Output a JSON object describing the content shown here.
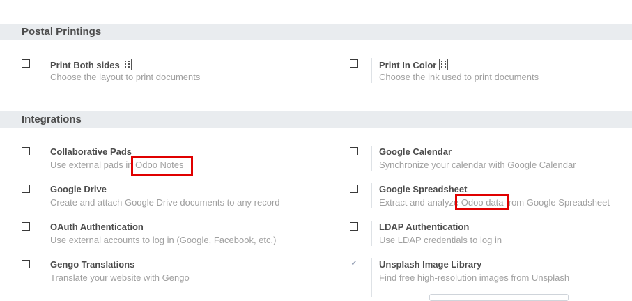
{
  "postal": {
    "header": "Postal Printings",
    "print_both": {
      "title": "Print Both sides",
      "desc": "Choose the layout to print documents"
    },
    "print_color": {
      "title": "Print In Color",
      "desc": "Choose the ink used to print documents"
    }
  },
  "integrations": {
    "header": "Integrations",
    "collab_pads": {
      "title": "Collaborative Pads",
      "desc_before": "Use external pads in ",
      "desc_highlight": "Odoo Notes",
      "checked": false
    },
    "google_calendar": {
      "title": "Google Calendar",
      "desc": "Synchronize your calendar with Google Calendar",
      "checked": false
    },
    "google_drive": {
      "title": "Google Drive",
      "desc": "Create and attach Google Drive documents to any record",
      "checked": false
    },
    "google_spreadsheet": {
      "title": "Google Spreadsheet",
      "desc_before": "Extract and analyze ",
      "desc_highlight": "Odoo data",
      "desc_after": " from Google Spreadsheet",
      "checked": false
    },
    "oauth": {
      "title": "OAuth Authentication",
      "desc": "Use external accounts to log in (Google, Facebook, etc.)",
      "checked": false
    },
    "ldap": {
      "title": "LDAP Authentication",
      "desc": "Use LDAP credentials to log in",
      "checked": false
    },
    "gengo": {
      "title": "Gengo Translations",
      "desc": "Translate your website with Gengo",
      "checked": false
    },
    "unsplash": {
      "title": "Unsplash Image Library",
      "desc": "Find free high-resolution images from Unsplash",
      "checked": true
    }
  },
  "icons": {
    "building": "building-icon",
    "checkmark": "✔"
  },
  "colors": {
    "highlight_border": "#e00000",
    "section_bg": "#e9ecef"
  }
}
